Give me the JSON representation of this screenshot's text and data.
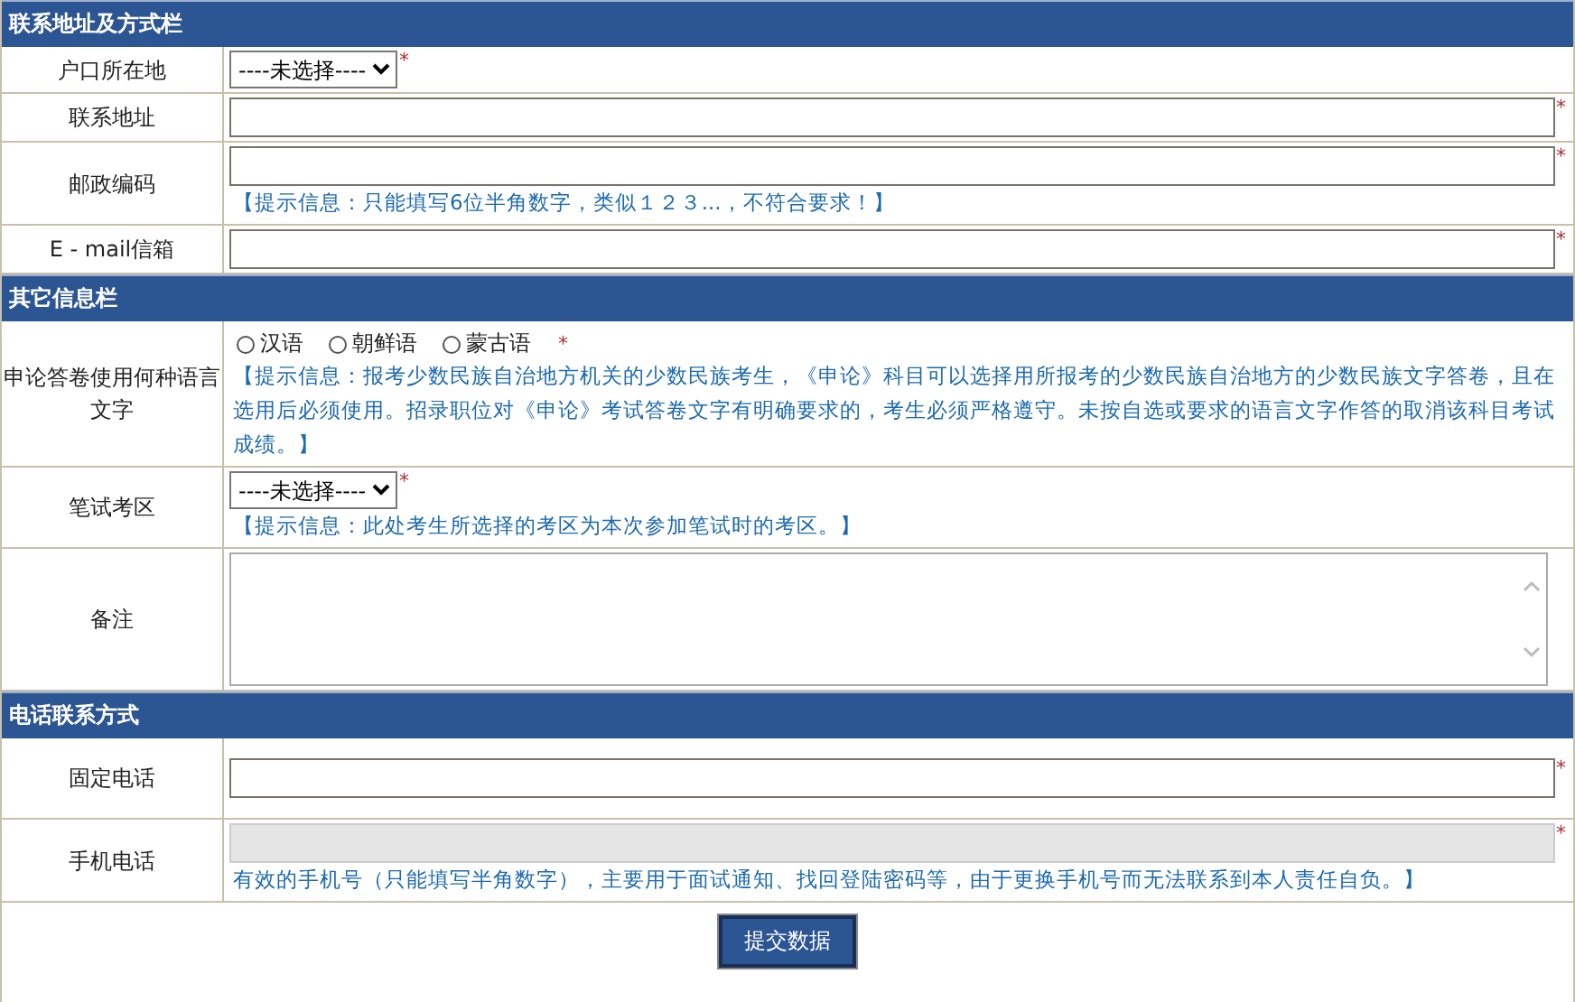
{
  "sections": [
    {
      "title": "联系地址及方式栏",
      "rows": [
        {
          "label": "户口所在地",
          "kind": "select",
          "value": "----未选择----",
          "required": "*"
        },
        {
          "label": "联系地址",
          "kind": "text",
          "required": "*"
        },
        {
          "label": "邮政编码",
          "kind": "text",
          "required": "*",
          "hint": "【提示信息：只能填写6位半角数字，类似１２３...，不符合要求！】"
        },
        {
          "label": "E - mail信箱",
          "kind": "text",
          "required": "*"
        }
      ]
    },
    {
      "title": "其它信息栏",
      "rows": [
        {
          "label": "申论答卷使用何种语言文字",
          "kind": "radio",
          "required": "*",
          "options": [
            {
              "label": "汉语",
              "selected": false
            },
            {
              "label": "朝鲜语",
              "selected": false
            },
            {
              "label": "蒙古语",
              "selected": false
            }
          ],
          "hint": "【提示信息：报考少数民族自治地方机关的少数民族考生，《申论》科目可以选择用所报考的少数民族自治地方的少数民族文字答卷，且在选用后必须使用。招录职位对《申论》考试答卷文字有明确要求的，考生必须严格遵守。未按自选或要求的语言文字作答的取消该科目考试成绩。】"
        },
        {
          "label": "笔试考区",
          "kind": "select",
          "value": "----未选择----",
          "required": "*",
          "hint": "【提示信息：此处考生所选择的考区为本次参加笔试时的考区。】"
        },
        {
          "label": "备注",
          "kind": "textarea"
        }
      ]
    },
    {
      "title": "电话联系方式",
      "rows": [
        {
          "label": "固定电话",
          "kind": "text",
          "required": "*"
        },
        {
          "label": "手机电话",
          "kind": "text",
          "required": "*",
          "disabled": true,
          "hint": "有效的手机号（只能填写半角数字），主要用于面试通知、找回登陆密码等，由于更换手机号而无法联系到本人责任自负。】"
        }
      ]
    }
  ],
  "submit": "提交数据"
}
